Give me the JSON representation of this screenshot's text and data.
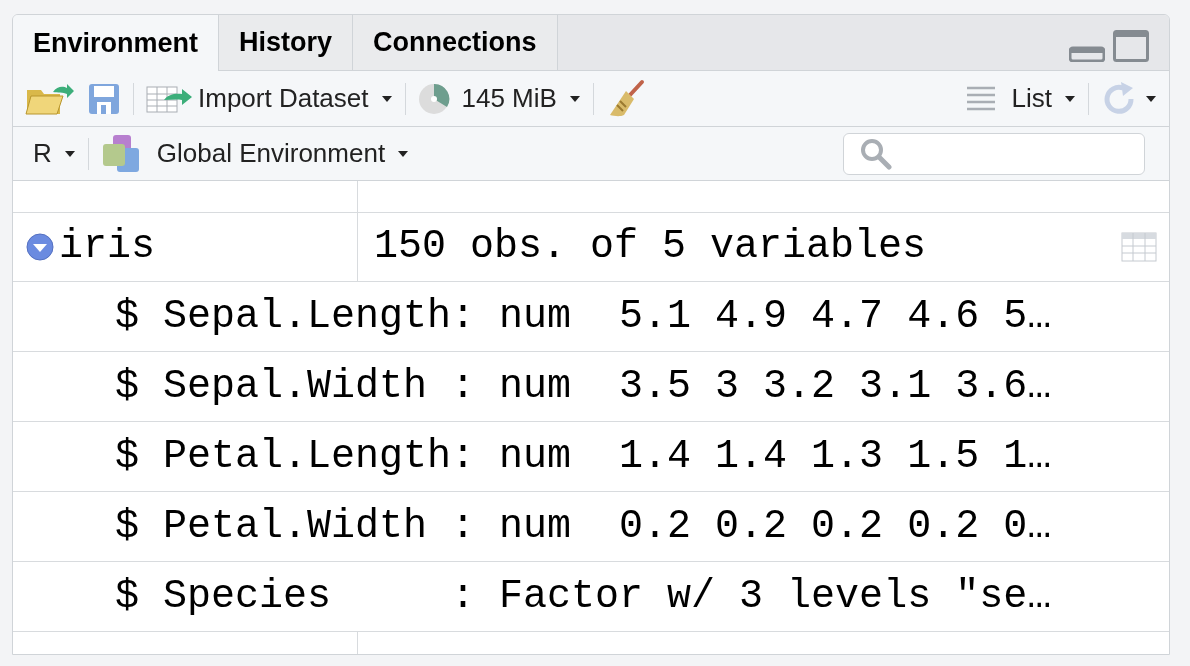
{
  "tabs": [
    {
      "label": "Environment",
      "selected": true
    },
    {
      "label": "History",
      "selected": false
    },
    {
      "label": "Connections",
      "selected": false
    }
  ],
  "toolbar": {
    "import": "Import Dataset",
    "memory": "145 MiB",
    "view": "List"
  },
  "env_bar": {
    "language": "R",
    "environment": "Global Environment"
  },
  "object": {
    "name": "iris",
    "summary": "150 obs. of 5 variables",
    "expanded": true
  },
  "fields": [
    {
      "text": "$ Sepal.Length: num  5.1 4.9 4.7 4.6 5…"
    },
    {
      "text": "$ Sepal.Width : num  3.5 3 3.2 3.1 3.6…"
    },
    {
      "text": "$ Petal.Length: num  1.4 1.4 1.3 1.5 1…"
    },
    {
      "text": "$ Petal.Width : num  0.2 0.2 0.2 0.2 0…"
    },
    {
      "text": "$ Species     : Factor w/ 3 levels \"se…"
    }
  ]
}
